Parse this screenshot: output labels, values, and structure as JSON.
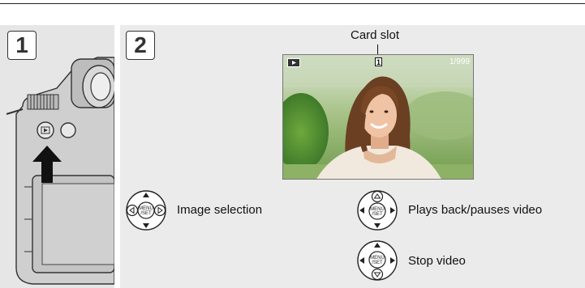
{
  "steps": {
    "step1": "1",
    "step2": "2"
  },
  "labels": {
    "card_slot": "Card slot",
    "card_slot_number": "1",
    "image_counter": "1/999",
    "image_selection": "Image selection",
    "plays_back": "Plays back/pauses video",
    "stop_video": "Stop video"
  },
  "dial": {
    "center_label_top": "MENU",
    "center_label_bottom": "/SET"
  },
  "icons": {
    "playback": "playback-icon",
    "camera": "camera-body-illustration",
    "arrow": "pointer-arrow-icon"
  }
}
